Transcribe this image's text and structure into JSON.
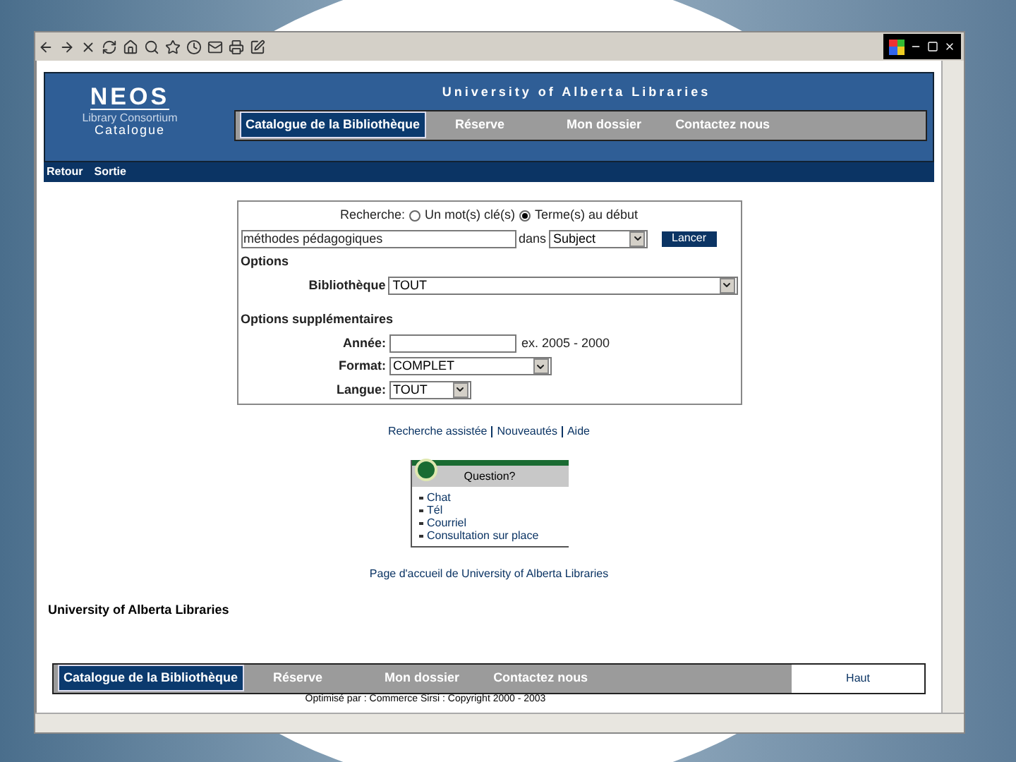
{
  "header": {
    "logo": "NEOS",
    "logo_line1": "Library Consortium",
    "logo_line2": "Catalogue",
    "title": "University of Alberta Libraries",
    "nav": [
      {
        "label": "Catalogue de la Bibliothèque",
        "selected": true
      },
      {
        "label": "Réserve",
        "selected": false
      },
      {
        "label": "Mon dossier",
        "selected": false
      },
      {
        "label": "Contactez nous",
        "selected": false
      }
    ]
  },
  "subnav": [
    "Retour",
    "Sortie"
  ],
  "search": {
    "label": "Recherche:",
    "modes": [
      {
        "label": "Un mot(s) clé(s)",
        "selected": false
      },
      {
        "label": "Terme(s) au début",
        "selected": true
      }
    ],
    "query": "méthodes pédagogiques",
    "in_label": "dans",
    "field": "Subject",
    "submit": "Lancer",
    "options_heading": "Options",
    "library": {
      "label": "Bibliothèque",
      "value": "TOUT"
    },
    "more_heading": "Options supplémentaires",
    "year": {
      "label": "Année:",
      "hint": "ex. 2005 - 2000"
    },
    "format": {
      "label": "Format:",
      "value": "COMPLET"
    },
    "language": {
      "label": "Langue:",
      "value": "TOUT"
    }
  },
  "links": [
    "Recherche assistée",
    "Nouveautés",
    "Aide"
  ],
  "help_box": {
    "title": "Question?",
    "items": [
      "Chat",
      "Tél",
      "Courriel",
      "Consultation sur place"
    ]
  },
  "home_link": "Page d'accueil de University of Alberta Libraries",
  "footer_title": "University of Alberta Libraries",
  "footer_nav": [
    {
      "label": "Catalogue de la Bibliothèque",
      "selected": true
    },
    {
      "label": "Réserve",
      "selected": false
    },
    {
      "label": "Mon dossier",
      "selected": false
    },
    {
      "label": "Contactez nous",
      "selected": false
    }
  ],
  "top_link": "Haut",
  "copyright": "Optimisé par : Commerce Sirsi : Copyright 2000 - 2003"
}
